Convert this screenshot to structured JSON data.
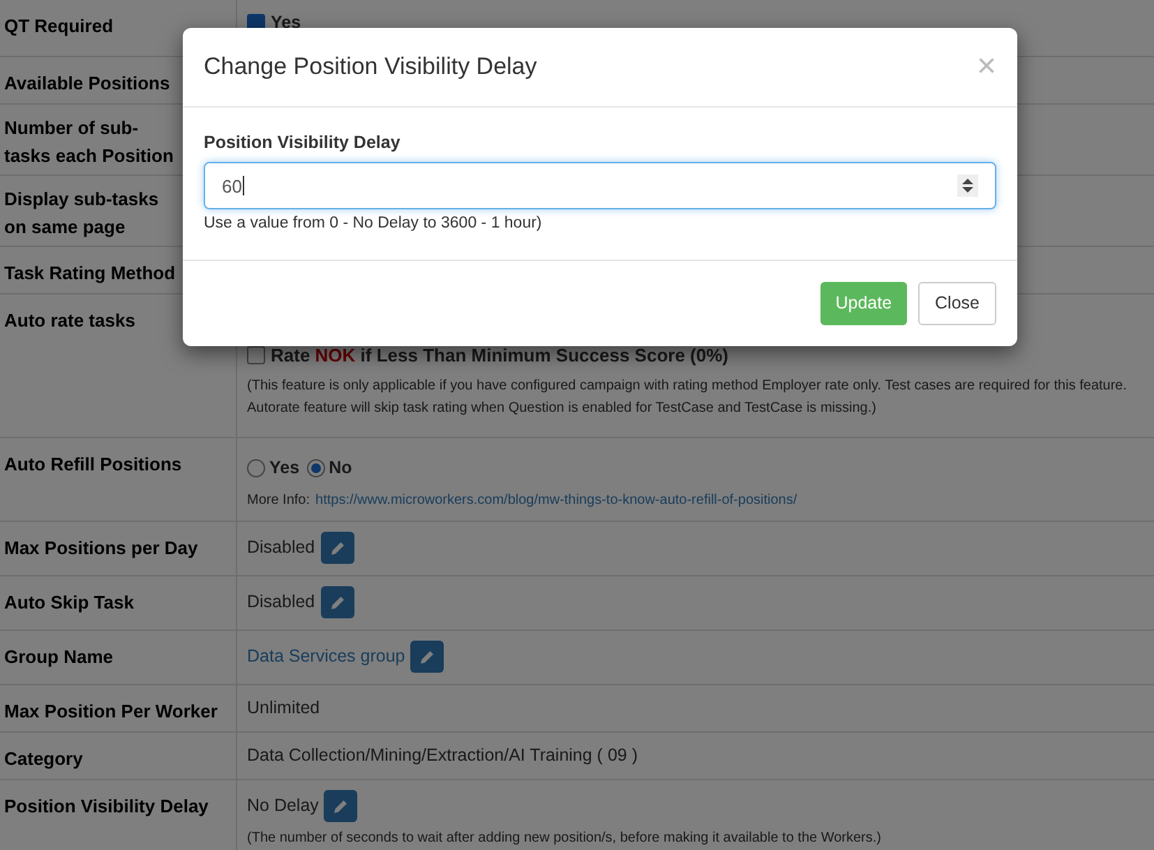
{
  "rows": [
    {
      "label": "QT Required",
      "checkbox": {
        "checked": true,
        "label": "Yes"
      }
    },
    {
      "label": "Available Positions"
    },
    {
      "label": "Number of sub-tasks each Position"
    },
    {
      "label": "Display sub-tasks on same page"
    },
    {
      "label": "Task Rating Method"
    },
    {
      "label": "Auto rate tasks",
      "rate_option": {
        "checked": false,
        "before": "Rate ",
        "highlight": "NOK",
        "after": " if Less Than Minimum Success Score (0%)"
      },
      "note": "(This feature is only applicable if you have configured campaign with rating method Employer rate only. Test cases are required for this feature. Autorate feature will skip task rating when Question is enabled for TestCase and TestCase is missing.)"
    },
    {
      "label": "Auto Refill Positions",
      "radios": [
        {
          "label": "Yes",
          "selected": false
        },
        {
          "label": "No",
          "selected": true
        }
      ],
      "more_info": {
        "prefix": "More Info:",
        "url": "https://www.microworkers.com/blog/mw-things-to-know-auto-refill-of-positions/"
      }
    },
    {
      "label": "Max Positions per Day",
      "value": "Disabled",
      "editable": true
    },
    {
      "label": "Auto Skip Task",
      "value": "Disabled",
      "editable": true
    },
    {
      "label": "Group Name",
      "link": "Data Services group",
      "editable": true
    },
    {
      "label": "Max Position Per Worker",
      "value": "Unlimited",
      "editable": false
    },
    {
      "label": "Category",
      "value": "Data Collection/Mining/Extraction/AI Training ( 09 )",
      "editable": false
    },
    {
      "label": "Position Visibility Delay",
      "value": "No Delay",
      "editable": true,
      "note": "(The number of seconds to wait after adding new position/s, before making it available to the Workers.)"
    }
  ],
  "modal": {
    "title": "Change Position Visibility Delay",
    "close": "×",
    "field_label": "Position Visibility Delay",
    "field_value": "60",
    "help": "Use a value from 0 - No Delay to 3600 - 1 hour)",
    "buttons": [
      {
        "label": "Update",
        "kind": "primary"
      },
      {
        "label": "Close",
        "kind": "default"
      }
    ]
  }
}
